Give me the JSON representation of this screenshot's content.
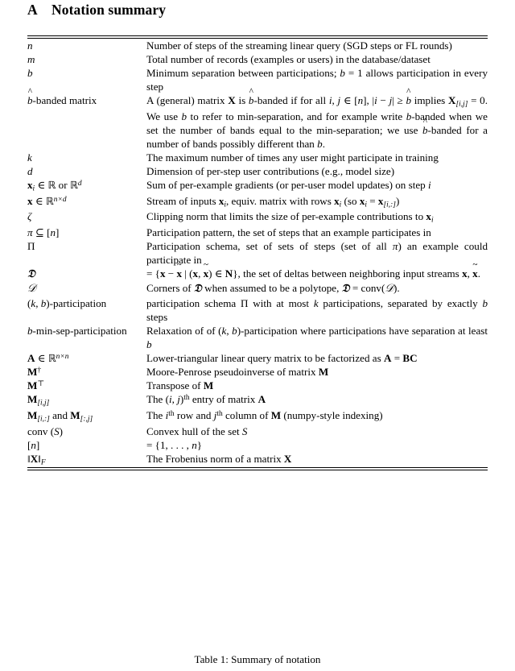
{
  "heading": {
    "number": "A",
    "title": "Notation summary"
  },
  "table": {
    "caption_label": "Table 1:",
    "caption_text": "Summary of notation",
    "caption_full": "Table 1: Summary of notation",
    "rows": [
      {
        "symbol": "n",
        "description": "Number of steps of the streaming linear query (SGD steps or FL rounds)"
      },
      {
        "symbol": "m",
        "description": "Total number of records (examples or users) in the database/dataset"
      },
      {
        "symbol": "b",
        "description": "Minimum separation between participations; b = 1 allows participation in every step"
      },
      {
        "symbol": "b̂-banded matrix",
        "description": "A (general) matrix X is b̂-banded if for all i, j ∈ [n], |i − j| ≥ b̂ implies X[i,j] = 0. We use b to refer to min-separation, and for example write b-banded when we set the number of bands equal to the min-separation; we use b̂-banded for a number of bands possibly different than b."
      },
      {
        "symbol": "k",
        "description": "The maximum number of times any user might participate in training"
      },
      {
        "symbol": "d",
        "description": "Dimension of per-step user contributions (e.g., model size)"
      },
      {
        "symbol": "xi ∈ ℝ or ℝ^d",
        "description": "Sum of per-example gradients (or per-user model updates) on step i"
      },
      {
        "symbol": "x ∈ ℝ^{n×d}",
        "description": "Stream of inputs xi, equiv. matrix with rows xi (so xi = x[i,:])"
      },
      {
        "symbol": "ζ",
        "description": "Clipping norm that limits the size of per-example contributions to xi"
      },
      {
        "symbol": "π ⊆ [n]",
        "description": "Participation pattern, the set of steps that an example participates in"
      },
      {
        "symbol": "Π",
        "description": "Participation schema, set of sets of steps (set of all π) an example could participate in"
      },
      {
        "symbol": "𝔇",
        "description": "= {x − x̃ | (x, x̃) ∈ N}, the set of deltas between neighboring input streams x, x̃."
      },
      {
        "symbol": "𝒟",
        "description": "Corners of 𝔇 when assumed to be a polytope, 𝔇 = conv(𝒟)."
      },
      {
        "symbol": "(k, b)-participation",
        "description": "participation schema Π with at most k participations, separated by exactly b steps"
      },
      {
        "symbol": "b-min-sep-participation",
        "description": "Relaxation of of (k, b)-participation where participations have separation at least b"
      },
      {
        "symbol": "A ∈ ℝ^{n×n}",
        "description": "Lower-triangular linear query matrix to be factorized as A = BC"
      },
      {
        "symbol": "M†",
        "description": "Moore-Penrose pseudoinverse of matrix M"
      },
      {
        "symbol": "M⊤",
        "description": "Transpose of M"
      },
      {
        "symbol": "M[i,j]",
        "description": "The (i, j)th entry of matrix A"
      },
      {
        "symbol": "M[i,:] and M[:,j]",
        "description": "The ith row and jth column of M (numpy-style indexing)"
      },
      {
        "symbol": "conv (S)",
        "description": "Convex hull of the set S"
      },
      {
        "symbol": "[n]",
        "description": "= {1, . . . , n}"
      },
      {
        "symbol": "‖X‖F",
        "description": "The Frobenius norm of a matrix X"
      }
    ]
  }
}
